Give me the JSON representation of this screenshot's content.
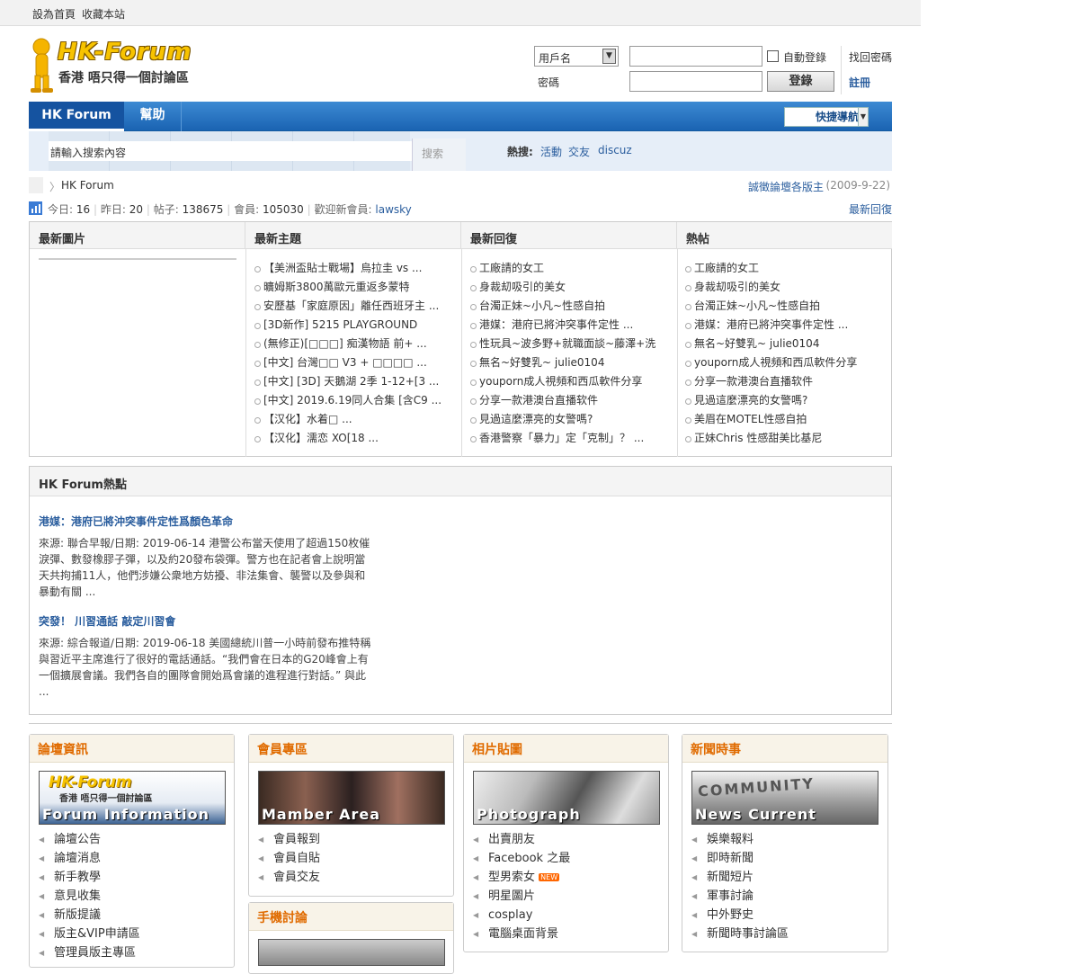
{
  "topbar": {
    "set_home": "設為首頁",
    "bookmark": "收藏本站"
  },
  "logo": {
    "brand": "HK-Forum",
    "slogan": "香港 唔只得一個討論區"
  },
  "login": {
    "username_select": "用戶名",
    "password_label": "密碼",
    "auto_login_label": "自動登錄",
    "login_button": "登錄",
    "find_password": "找回密碼",
    "register": "註冊"
  },
  "nav": {
    "home": "HK Forum",
    "help": "幫助",
    "quick_nav": "快捷導航"
  },
  "search": {
    "placeholder": "請輸入搜索內容",
    "button": "搜索",
    "hot_label": "熱搜:",
    "hot_terms": [
      "活動",
      "交友",
      "discuz"
    ]
  },
  "breadcrumb": {
    "current": "HK Forum",
    "notice": "誠徵論壇各版主",
    "notice_date": "(2009-9-22)"
  },
  "stats": {
    "today_label": "今日:",
    "today": "16",
    "yesterday_label": "昨日:",
    "yesterday": "20",
    "posts_label": "帖子:",
    "posts": "138675",
    "members_label": "會員:",
    "members": "105030",
    "welcome_label": "歡迎新會員:",
    "newest_member": "lawsky",
    "latest_reply": "最新回復"
  },
  "columns": {
    "pics": {
      "title": "最新圖片"
    },
    "threads": {
      "title": "最新主題",
      "items": [
        "【美洲盃貼士戰場】烏拉圭 vs ...",
        "曠姆斯3800萬歐元重返多蒙特",
        "安歷基「家庭原因」離任西班牙主 ...",
        "[3D新作] 5215 PLAYGROUND",
        "(無修正)[□□□] 痴漢物語 前+ ...",
        "[中文] 台灣□□ V3 + □□□□ ...",
        "[中文] [3D] 天鵝湖 2季 1-12+[3 ...",
        "[中文] 2019.6.19同人合集 [含C9 ...",
        "【汉化】水着□ ...",
        "【汉化】濡恋 XO[18 ..."
      ]
    },
    "replies": {
      "title": "最新回復",
      "items": [
        "工廠請的女工",
        "身裁刧吸引的美女",
        "台濁正妹~小凡~性感自拍",
        "港媒：港府已將沖突事件定性 ...",
        "性玩具~波多野+就職面談~藤澤+洗",
        "無名~好雙乳~ julie0104",
        "youporn成人視頻和西瓜軟件分享",
        "分享一款港澳台直播软件",
        "見過這麼漂亮的女警嗎?",
        "香港警察「暴力」定「克制」？ ..."
      ]
    },
    "hot": {
      "title": "熱帖",
      "items": [
        "工廠請的女工",
        "身裁刧吸引的美女",
        "台濁正妹~小凡~性感自拍",
        "港媒：港府已將沖突事件定性 ...",
        "無名~好雙乳~ julie0104",
        "youporn成人視頻和西瓜軟件分享",
        "分享一款港澳台直播软件",
        "見過這麼漂亮的女警嗎?",
        "美眉在MOTEL性感自拍",
        "正妹Chris 性感甜美比基尼"
      ]
    }
  },
  "hotspot": {
    "title": "HK Forum熱點",
    "articles": [
      {
        "headline": "港媒：港府已將沖突事件定性爲顏色革命",
        "l1": "來源: 聯合早報/日期: 2019-06-14 港警公布當天使用了超過150枚催",
        "l2": "淚彈、數發橡膠子彈，以及約20發布袋彈。警方也在記者會上說明當",
        "l3": "天共拘捕11人，他們涉嫌公衆地方妨擾、非法集會、襲警以及參與和",
        "l4": "暴動有關 ..."
      },
      {
        "headline": "突發！ 川習通話 敲定川習會",
        "l1": "來源: 綜合報道/日期: 2019-06-18 美國總統川普一小時前發布推特稱",
        "l2": "與習近平主席進行了很好的電話通話。“我們會在日本的G20峰會上有",
        "l3": "一個擴展會議。我們各自的團隊會開始爲會議的進程進行對話。” 與此",
        "l4": "..."
      }
    ]
  },
  "categories": [
    {
      "title": "論壇資訊",
      "banner": "Forum Information",
      "items": [
        "論壇公告",
        "論壇消息",
        "新手教學",
        "意見收集",
        "新版提議",
        "版主&VIP申請區",
        "管理員版主專區"
      ]
    },
    {
      "title": "會員專區",
      "banner": "Mamber Area",
      "items": [
        "會員報到",
        "會員自貼",
        "會員交友"
      ]
    },
    {
      "title": "相片貼圖",
      "banner": "Photograph",
      "items": [
        "出賣朋友",
        "Facebook 之最",
        "型男索女",
        "明星圖片",
        "cosplay",
        "電腦桌面背景"
      ],
      "new_badge": "NEW"
    },
    {
      "title": "新聞時事",
      "banner": "News Current",
      "items": [
        "娛樂報料",
        "即時新聞",
        "新聞短片",
        "軍事討論",
        "中外野史",
        "新聞時事討論區"
      ]
    }
  ],
  "mobile": {
    "title": "手機討論"
  }
}
